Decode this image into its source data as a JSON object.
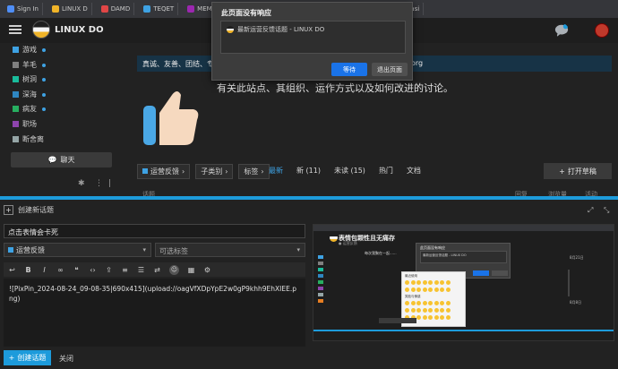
{
  "browser": {
    "tabs": [
      {
        "label": "Sign In",
        "color": "#4f8ef7"
      },
      {
        "label": "LINUX D",
        "color": "#f0b429"
      },
      {
        "label": "DAMD",
        "color": "#e04646"
      },
      {
        "label": "TEQET",
        "color": "#3ea2e3"
      },
      {
        "label": "MEMD",
        "color": "#9c27b0"
      },
      {
        "label": "MEDI",
        "color": "#4caf50"
      },
      {
        "label": "MILI",
        "color": "#ff7043"
      },
      {
        "label": "FE/VFS",
        "color": "#3ea2e3"
      },
      {
        "label": "RIDDL",
        "color": "#e04646"
      },
      {
        "label": "Akasi",
        "color": "#8e8e8e"
      }
    ]
  },
  "header": {
    "site_title": "LINUX DO",
    "colors": {
      "chat_icon": "#aab0b6",
      "avatar": "#c0392b"
    }
  },
  "sidebar": {
    "items": [
      {
        "label": "游戏",
        "color": "#3ea2e3",
        "unread": true
      },
      {
        "label": "羊毛",
        "color": "#808080",
        "unread": true
      },
      {
        "label": "树洞",
        "color": "#1abc9c",
        "unread": true
      },
      {
        "label": "深海",
        "color": "#2e86c1",
        "unread": true
      },
      {
        "label": "病友",
        "color": "#27ae60",
        "unread": true
      },
      {
        "label": "职场",
        "color": "#8e44ad",
        "unread": false
      },
      {
        "label": "断舍离",
        "color": "#95a5a6",
        "unread": false
      }
    ],
    "chat_label": "聊天"
  },
  "main": {
    "banner_text": "真诚、友善、团结、专",
    "banner_tail": "org",
    "about_text": "有关此站点、其组织、运作方式以及如何改进的讨论。",
    "filters": {
      "category": "运营反馈",
      "subcategory": "子类别",
      "tags": "标签"
    },
    "nav_tabs": [
      {
        "label": "最新",
        "active": true
      },
      {
        "label": "新 (11)",
        "active": false
      },
      {
        "label": "未读 (15)",
        "active": false
      },
      {
        "label": "热门",
        "active": false
      },
      {
        "label": "文档",
        "active": false
      }
    ],
    "create_topic_label": "打开草稿",
    "columns": [
      "话题",
      "回复",
      "浏览量",
      "活动"
    ]
  },
  "dialog": {
    "title": "此页面没有响应",
    "page_item": "最新运营反馈话题 - LINUX DO",
    "wait_label": "等待",
    "exit_label": "退出页面"
  },
  "composer": {
    "header_label": "创建新话题",
    "title_value": "点击表情会卡死",
    "category_value": "运营反馈",
    "tags_placeholder": "可选标签",
    "editor_content": "![PixPin_2024-08-24_09-08-35|690x415](upload://oagVfXDpYpE2w0gP9khh9EhXIEE.png)",
    "submit_label": "创建话题",
    "close_label": "关闭"
  },
  "preview": {
    "site_title": "表情包颗性且无痛存",
    "site_subtitle": "● 运营反馈",
    "post_text": "每次我聚在一起......",
    "dialog_title": "此页面没有响应",
    "dialog_item": "最新运营反馈话题 - LINUX DO",
    "emoji_label_1": "最近使用",
    "emoji_label_2": "笑脸与情感",
    "date_1": "8月21日",
    "date_2": "8月8日",
    "reply_label": "聊天"
  }
}
